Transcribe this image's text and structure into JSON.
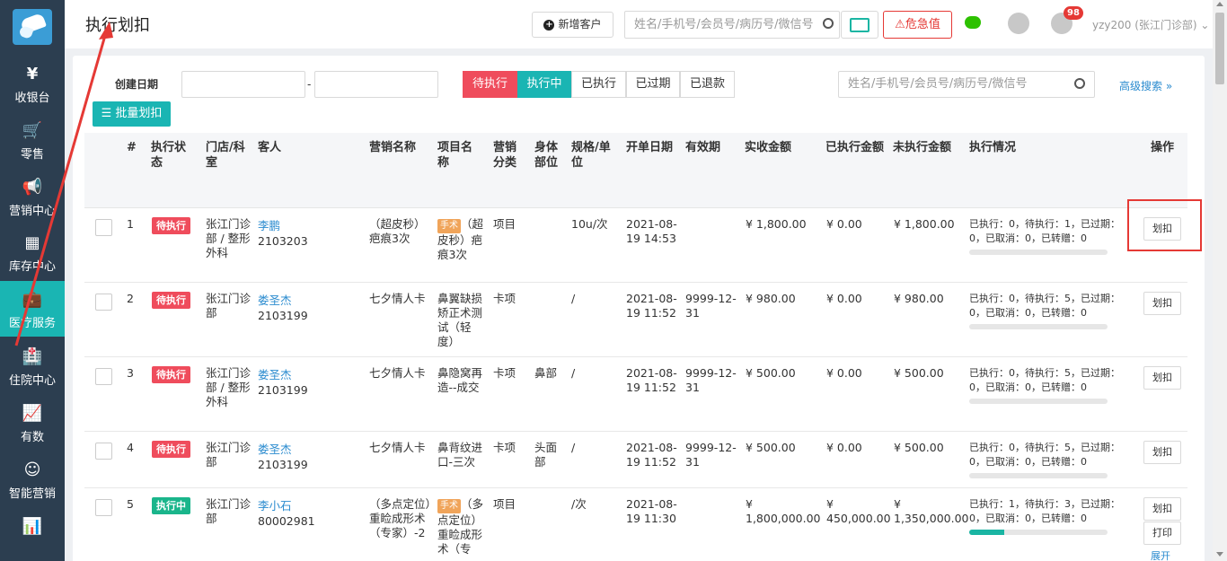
{
  "sidebar": {
    "items": [
      {
        "icon": "¥",
        "label": "收银台"
      },
      {
        "icon": "🛒",
        "label": "零售"
      },
      {
        "icon": "📢",
        "label": "营销中心"
      },
      {
        "icon": "▦",
        "label": "库存中心"
      },
      {
        "icon": "💼",
        "label": "医疗服务"
      },
      {
        "icon": "🏥",
        "label": "住院中心"
      },
      {
        "icon": "📈",
        "label": "有数"
      },
      {
        "icon": "☺",
        "label": "智能营销"
      },
      {
        "icon": "📊",
        "label": ""
      }
    ],
    "active_index": 4
  },
  "header": {
    "title": "执行划扣",
    "new_customer": "新增客户",
    "search_placeholder": "姓名/手机号/会员号/病历号/微信号",
    "critical_label": "危急值",
    "notification_count": "98",
    "user": "yzy200 (张江门诊部)"
  },
  "filters": {
    "date_label": "创建日期",
    "date_sep": "-",
    "tabs": [
      "待执行",
      "执行中",
      "已执行",
      "已过期",
      "已退款"
    ],
    "search_placeholder": "姓名/手机号/会员号/病历号/微信号",
    "advanced": "高级搜索",
    "batch_button": "批量划扣"
  },
  "table": {
    "columns": [
      "#",
      "执行状态",
      "门店/科室",
      "客人",
      "营销名称",
      "项目名称",
      "营销分类",
      "身体部位",
      "规格/单位",
      "开单日期",
      "有效期",
      "实收金额",
      "已执行金额",
      "未执行金额",
      "执行情况",
      "操作"
    ],
    "rows": [
      {
        "no": "1",
        "status": "待执行",
        "store": "张江门诊部 / 整形外科",
        "name": "李鹏",
        "id": "2103203",
        "marketing": "（超皮秒）疤痕3次",
        "tag": "手术",
        "project": "（超皮秒）疤痕3次",
        "category": "项目",
        "body": "",
        "spec": "10u/次",
        "date": "2021-08-19 14:53",
        "valid": "",
        "received": "¥ 1,800.00",
        "executed": "¥ 0.00",
        "unexecuted": "¥ 1,800.00",
        "progress_text": "已执行：0，待执行：1，已过期：0，已取消：0，已转赠：0",
        "progress": 0,
        "ops": [
          "划扣"
        ]
      },
      {
        "no": "2",
        "status": "待执行",
        "store": "张江门诊部",
        "name": "娄圣杰",
        "id": "2103199",
        "marketing": "七夕情人卡",
        "tag": "",
        "project": "鼻翼缺损矫正术测试（轻度）",
        "category": "卡项",
        "body": "",
        "spec": "/",
        "date": "2021-08-19 11:52",
        "valid": "9999-12-31",
        "received": "¥ 980.00",
        "executed": "¥ 0.00",
        "unexecuted": "¥ 980.00",
        "progress_text": "已执行：0，待执行：5，已过期：0，已取消：0，已转赠：0",
        "progress": 0,
        "ops": [
          "划扣"
        ]
      },
      {
        "no": "3",
        "status": "待执行",
        "store": "张江门诊部 / 整形外科",
        "name": "娄圣杰",
        "id": "2103199",
        "marketing": "七夕情人卡",
        "tag": "",
        "project": "鼻隐窝再造--成交",
        "category": "卡项",
        "body": "鼻部",
        "spec": "/",
        "date": "2021-08-19 11:52",
        "valid": "9999-12-31",
        "received": "¥ 500.00",
        "executed": "¥ 0.00",
        "unexecuted": "¥ 500.00",
        "progress_text": "已执行：0，待执行：5，已过期：0，已取消：0，已转赠：0",
        "progress": 0,
        "ops": [
          "划扣"
        ]
      },
      {
        "no": "4",
        "status": "待执行",
        "store": "张江门诊部",
        "name": "娄圣杰",
        "id": "2103199",
        "marketing": "七夕情人卡",
        "tag": "",
        "project": "鼻背纹进口-三次",
        "category": "卡项",
        "body": "头面部",
        "spec": "/",
        "date": "2021-08-19 11:52",
        "valid": "9999-12-31",
        "received": "¥ 500.00",
        "executed": "¥ 0.00",
        "unexecuted": "¥ 500.00",
        "progress_text": "已执行：0，待执行：5，已过期：0，已取消：0，已转赠：0",
        "progress": 0,
        "ops": [
          "划扣"
        ]
      },
      {
        "no": "5",
        "status": "执行中",
        "store": "张江门诊部",
        "name": "李小石",
        "id": "80002981",
        "marketing": "（多点定位）重睑成形术（专家）-2",
        "tag": "手术",
        "project": "（多点定位）重睑成形术（专",
        "category": "项目",
        "body": "",
        "spec": "/次",
        "date": "2021-08-19 11:30",
        "valid": "",
        "received": "¥ 1,800,000.00",
        "executed": "¥ 450,000.00",
        "unexecuted": "¥ 1,350,000.00",
        "progress_text": "已执行：1，待执行：3，已过期：0，已取消：0，已转赠：0",
        "progress": 0.25,
        "ops": [
          "划扣",
          "打印",
          "展开"
        ]
      }
    ]
  }
}
